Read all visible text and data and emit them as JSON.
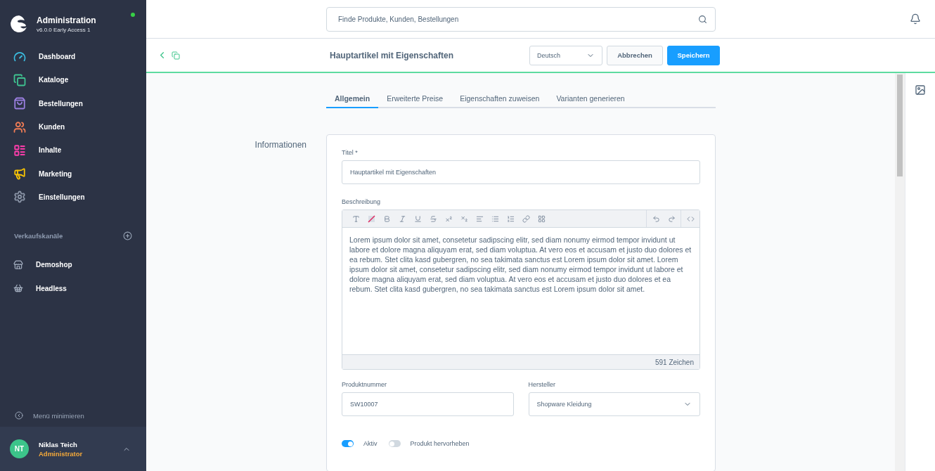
{
  "sidebar": {
    "app_title": "Administration",
    "version": "v6.0.0 Early Access 1",
    "online": true,
    "nav_items": [
      {
        "label": "Dashboard",
        "color": "#3bbde0"
      },
      {
        "label": "Kataloge",
        "color": "#3fc491"
      },
      {
        "label": "Bestellungen",
        "color": "#9a7fe0"
      },
      {
        "label": "Kunden",
        "color": "#f07c55"
      },
      {
        "label": "Inhalte",
        "color": "#ff3dac"
      },
      {
        "label": "Marketing",
        "color": "#f9c404"
      },
      {
        "label": "Einstellungen",
        "color": "#8b95a7"
      }
    ],
    "sales_channels_title": "Verkaufskanäle",
    "sales_channels": [
      {
        "label": "Demoshop"
      },
      {
        "label": "Headless"
      }
    ],
    "collapse_label": "Menü minimieren",
    "user": {
      "initials": "NT",
      "name": "Niklas Teich",
      "role": "Administrator"
    }
  },
  "search": {
    "placeholder": "Finde Produkte, Kunden, Bestellungen"
  },
  "smart_bar": {
    "title": "Hauptartikel mit Eigenschaften",
    "language": "Deutsch",
    "cancel": "Abbrechen",
    "save": "Speichern"
  },
  "tabs": [
    {
      "label": "Allgemein",
      "selected": true
    },
    {
      "label": "Erweiterte Preise",
      "selected": false
    },
    {
      "label": "Eigenschaften zuweisen",
      "selected": false
    },
    {
      "label": "Varianten generieren",
      "selected": false
    }
  ],
  "section_title": "Informationen",
  "form": {
    "title_label": "Titel *",
    "title_value": "Hauptartikel mit Eigenschaften",
    "description_label": "Beschreibung",
    "description": "Lorem ipsum dolor sit amet, consetetur sadipscing elitr, sed diam nonumy eirmod tempor invidunt ut labore et dolore magna aliquyam erat, sed diam voluptua. At vero eos et accusam et justo duo dolores et ea rebum. Stet clita kasd gubergren, no sea takimata sanctus est Lorem ipsum dolor sit amet. Lorem ipsum dolor sit amet, consetetur sadipscing elitr, sed diam nonumy eirmod tempor invidunt ut labore et dolore magna aliquyam erat, sed diam voluptua. At vero eos et accusam et justo duo dolores et ea rebum. Stet clita kasd gubergren, no sea takimata sanctus est Lorem ipsum dolor sit amet.",
    "char_count": "591 Zeichen",
    "number_label": "Produktnummer",
    "number_value": "SW10007",
    "manufacturer_label": "Hersteller",
    "manufacturer_value": "Shopware Kleidung",
    "toggles": [
      {
        "label": "Aktiv",
        "on": true
      },
      {
        "label": "Produkt hervorheben",
        "on": false
      }
    ]
  }
}
